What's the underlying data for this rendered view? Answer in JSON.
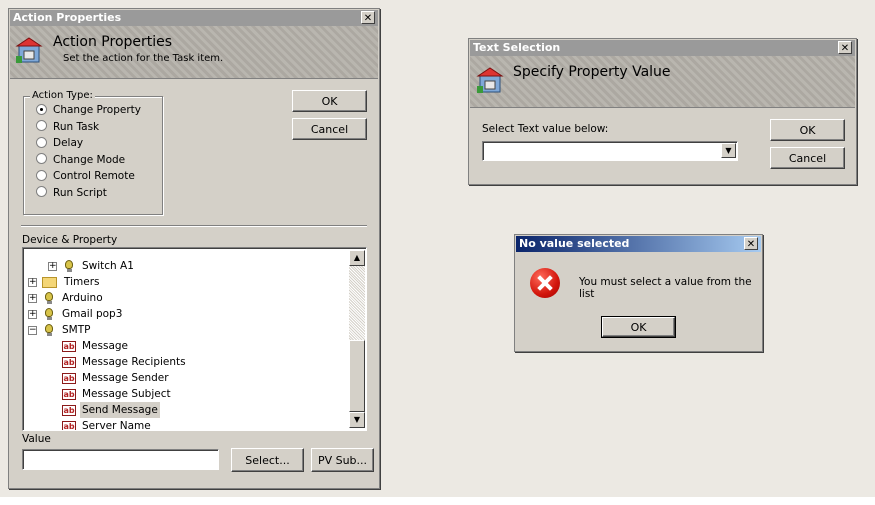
{
  "action_properties": {
    "title": "Action Properties",
    "header_title": "Action Properties",
    "header_subtitle": "Set the action for the Task item.",
    "ok_label": "OK",
    "cancel_label": "Cancel",
    "action_type_label": "Action Type:",
    "action_types": [
      {
        "label": "Change Property",
        "selected": true
      },
      {
        "label": "Run Task",
        "selected": false
      },
      {
        "label": "Delay",
        "selected": false
      },
      {
        "label": "Change Mode",
        "selected": false
      },
      {
        "label": "Control Remote",
        "selected": false
      },
      {
        "label": "Run Script",
        "selected": false
      }
    ],
    "device_property_label": "Device & Property",
    "tree": [
      {
        "label": "Switch A1",
        "icon": "bulb-icon",
        "expander": "+"
      },
      {
        "label": "Timers",
        "icon": "folder-icon",
        "expander": "+"
      },
      {
        "label": "Arduino",
        "icon": "bulb-icon",
        "expander": "+"
      },
      {
        "label": "Gmail pop3",
        "icon": "bulb-icon",
        "expander": "+"
      },
      {
        "label": "SMTP",
        "icon": "bulb-icon",
        "expander": "-"
      },
      {
        "label": "Message",
        "icon": "text-property-icon"
      },
      {
        "label": "Message Recipients",
        "icon": "text-property-icon"
      },
      {
        "label": "Message Sender",
        "icon": "text-property-icon"
      },
      {
        "label": "Message Subject",
        "icon": "text-property-icon"
      },
      {
        "label": "Send Message",
        "icon": "text-property-icon",
        "selected": true
      },
      {
        "label": "Server Name",
        "icon": "text-property-icon"
      }
    ],
    "ab_glyph": "ab",
    "value_label": "Value",
    "value_text": "",
    "select_label": "Select...",
    "pv_sub_label": "PV Sub..."
  },
  "text_selection": {
    "title": "Text Selection",
    "header_title": "Specify Property Value",
    "select_label": "Select Text value below:",
    "combo_value": "",
    "ok_label": "OK",
    "cancel_label": "Cancel"
  },
  "no_value": {
    "title": "No value selected",
    "message": "You must select a value from the list",
    "ok_label": "OK"
  },
  "glyphs": {
    "close": "✕",
    "up_arrow": "▲",
    "down_arrow": "▼",
    "combo_arrow": "▼"
  },
  "colors": {
    "inactive_title": "#9a9a9a",
    "active_title": "#0a246a",
    "face": "#d4d0c8"
  }
}
